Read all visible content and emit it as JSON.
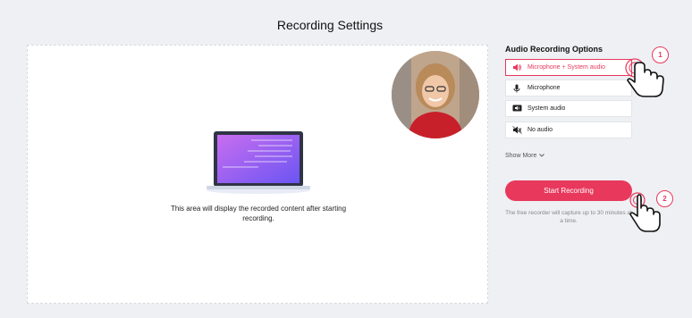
{
  "page": {
    "title": "Recording Settings"
  },
  "preview": {
    "caption": "This area will display the recorded content after starting recording."
  },
  "audio_panel": {
    "title": "Audio Recording Options",
    "options": [
      {
        "label": "Microphone + System audio",
        "icon": "speaker-icon",
        "selected": true
      },
      {
        "label": "Microphone",
        "icon": "microphone-icon",
        "selected": false
      },
      {
        "label": "System audio",
        "icon": "system-audio-icon",
        "selected": false
      },
      {
        "label": "No audio",
        "icon": "mute-icon",
        "selected": false
      }
    ],
    "show_more": "Show More"
  },
  "record": {
    "button_label": "Start Recording",
    "note": "The free recorder will capture up to 30 minutes at a time."
  },
  "annotations": {
    "step1": "1",
    "step2": "2"
  },
  "colors": {
    "accent": "#e8385c",
    "background": "#eef0f3"
  }
}
